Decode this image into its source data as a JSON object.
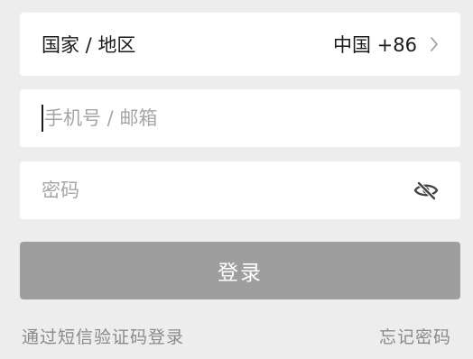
{
  "form": {
    "country_label": "国家 / 地区",
    "country_value": "中国 +86",
    "phone_placeholder": "手机号 / 邮箱",
    "password_placeholder": "密码"
  },
  "actions": {
    "login_label": "登录",
    "sms_login_label": "通过短信验证码登录",
    "forgot_password_label": "忘记密码"
  },
  "icons": {
    "chevron": "chevron-right-icon",
    "password_visibility": "eye-off-icon"
  },
  "colors": {
    "background": "#ededed",
    "field_background": "#ffffff",
    "button_disabled": "#9e9e9e",
    "text_primary": "#1a1a1a",
    "text_placeholder": "#a6a6a6",
    "link": "#8a8a8a"
  }
}
